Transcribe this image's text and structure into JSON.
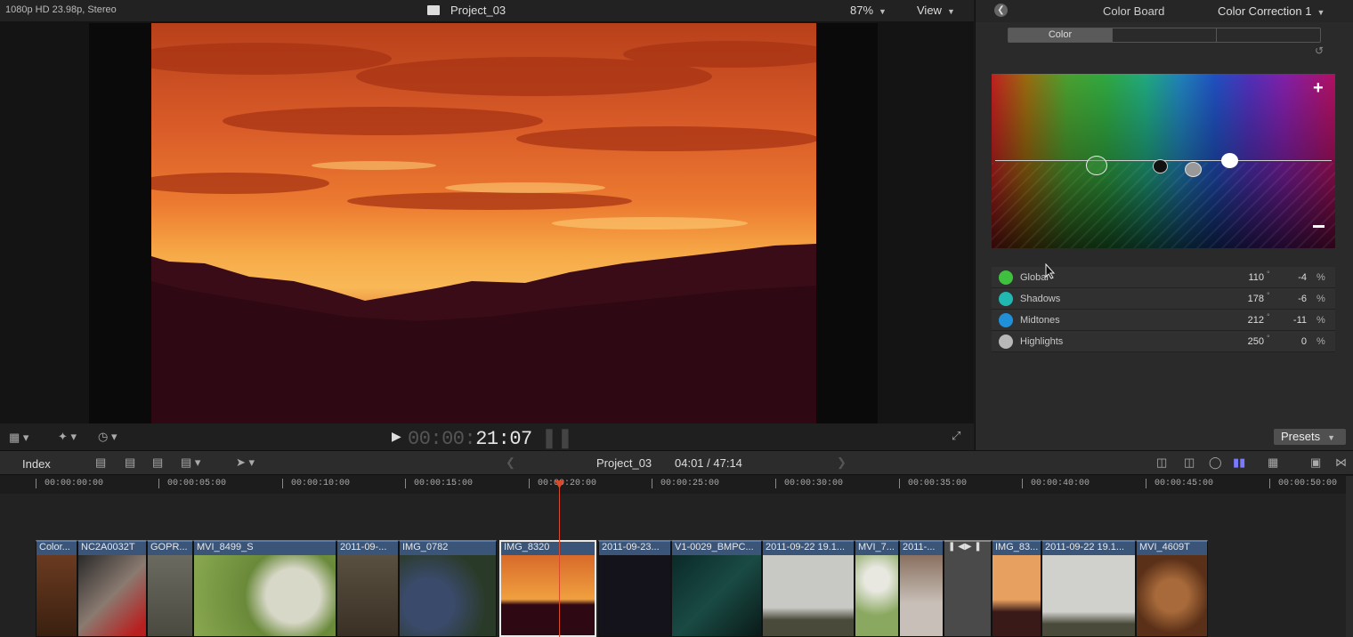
{
  "viewer": {
    "format": "1080p HD 23.98p, Stereo",
    "project_title": "Project_03",
    "zoom": "87%",
    "view_label": "View",
    "timecode_dim": "00:00:",
    "timecode": "21:07"
  },
  "inspector": {
    "title": "Color Board",
    "correction": "Color Correction 1",
    "tabs": [
      "Color",
      "",
      ""
    ],
    "presets_label": "Presets",
    "params": [
      {
        "name": "Global",
        "angle": "110",
        "percent": "-4",
        "icon_color": "#3fc13f"
      },
      {
        "name": "Shadows",
        "angle": "178",
        "percent": "-6",
        "icon_color": "#20b8b0"
      },
      {
        "name": "Midtones",
        "angle": "212",
        "percent": "-11",
        "icon_color": "#2090d8"
      },
      {
        "name": "Highlights",
        "angle": "250",
        "percent": "0",
        "icon_color": "#b8b8b8"
      }
    ],
    "unit_deg": "°",
    "unit_pct": "%"
  },
  "timeline": {
    "index_label": "Index",
    "project_title": "Project_03",
    "duration": "04:01 / 47:14",
    "ruler": [
      "00:00:00:00",
      "00:00:05:00",
      "00:00:10:00",
      "00:00:15:00",
      "00:00:20:00",
      "00:00:25:00",
      "00:00:30:00",
      "00:00:35:00",
      "00:00:40:00",
      "00:00:45:00",
      "00:00:50:00"
    ],
    "clips": [
      "Color...",
      "NC2A0032T",
      "GOPR...",
      "MVI_8499_S",
      "2011-09-...",
      "IMG_0782",
      "IMG_8320",
      "2011-09-23...",
      "V1-0029_BMPC...",
      "2011-09-22 19.1...",
      "MVI_7...",
      "2011-...",
      "",
      "IMG_83...",
      "2011-09-22 19.1...",
      "MVI_4609T"
    ]
  }
}
